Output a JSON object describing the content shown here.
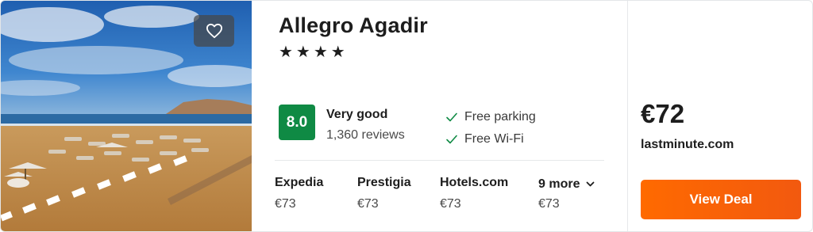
{
  "hotel": {
    "name": "Allegro Agadir",
    "stars": "★★★★",
    "score": "8.0",
    "rating_label": "Very good",
    "reviews": "1,360 reviews"
  },
  "amenities": [
    {
      "label": "Free parking",
      "icon": "check-icon"
    },
    {
      "label": "Free Wi-Fi",
      "icon": "check-icon"
    }
  ],
  "providers": [
    {
      "name": "Expedia",
      "price": "€73"
    },
    {
      "name": "Prestigia",
      "price": "€73"
    },
    {
      "name": "Hotels.com",
      "price": "€73"
    }
  ],
  "more_providers": {
    "label": "9 more",
    "price": "€73",
    "icon": "chevron-down-icon"
  },
  "best_deal": {
    "price": "€72",
    "site": "lastminute.com",
    "button_label": "View Deal"
  },
  "favorite": {
    "icon": "heart-icon"
  },
  "colors": {
    "score_bg": "#0f8a44",
    "deal_button": "#ff6a00",
    "check": "#0f8a44"
  }
}
